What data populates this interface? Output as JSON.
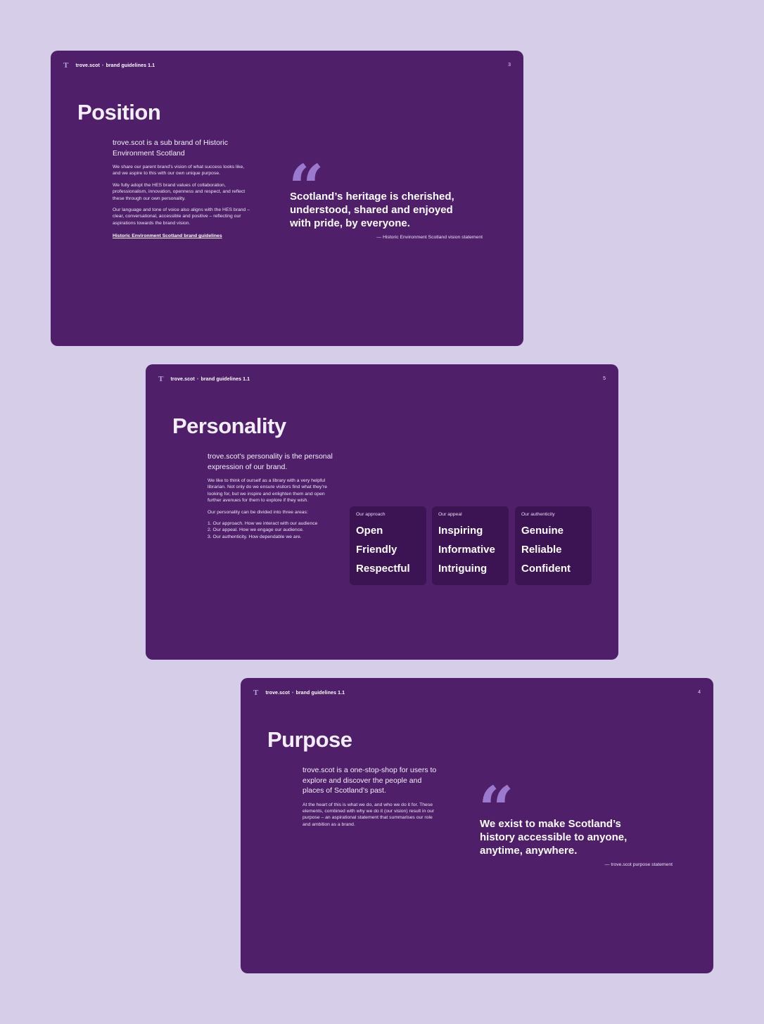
{
  "header": {
    "logo": "T",
    "brand": "trove.scot",
    "separator": "•",
    "doc": "brand guidelines 1.1"
  },
  "position": {
    "page": "3",
    "title": "Position",
    "lead": "trove.scot is a sub brand of Historic Environment Scotland",
    "paragraphs": [
      "We share our parent brand’s vision of what success looks like, and we aspire to this with our own unique purpose.",
      "We fully adopt the HES brand values of collaboration, professionalism, innovation, openness and respect, and reflect these through our own personality.",
      "Our language and tone of voice also aligns with the HES brand – clear, conversational, accessible and positive – reflecting our aspirations towards the brand vision."
    ],
    "link": "Historic Environment Scotland brand guidelines",
    "quote_mark": "“",
    "quote": "Scotland’s heritage is cherished, understood, shared and enjoyed with pride, by everyone.",
    "attribution": "— Historic Environment Scotland vision statement"
  },
  "personality": {
    "page": "5",
    "title": "Personality",
    "lead": "trove.scot’s personality is the personal expression of our brand.",
    "paragraphs": [
      "We like to think of ourself as a library with a very helpful librarian. Not only do we ensure visitors find what they’re looking for, but we inspire and enlighten them and open further avenues for them to explore if they wish.",
      "Our personality can be divided into three areas:"
    ],
    "list": [
      "1.  Our approach. How we interact with our audience",
      "2.  Our appeal. How we engage our audience.",
      "3.  Our authenticity. How dependable we are."
    ],
    "cards": [
      {
        "heading": "Our approach",
        "words": [
          "Open",
          "Friendly",
          "Respectful"
        ]
      },
      {
        "heading": "Our appeal",
        "words": [
          "Inspiring",
          "Informative",
          "Intriguing"
        ]
      },
      {
        "heading": "Our authenticity",
        "words": [
          "Genuine",
          "Reliable",
          "Confident"
        ]
      }
    ]
  },
  "purpose": {
    "page": "4",
    "title": "Purpose",
    "lead": "trove.scot is a one-stop-shop for users to explore and discover the people and places of Scotland’s past.",
    "paragraphs": [
      "At the heart of this is what we do, and who we do it for. These elements, combined with why we do it (our vision) result in our purpose – an aspirational statement that summarises our role and ambition as a brand."
    ],
    "quote_mark": "“",
    "quote": "We exist to make Scotland’s history accessible to anyone, anytime, anywhere.",
    "attribution": "— trove.scot purpose statement"
  },
  "colors": {
    "page_background": "#d6cee8",
    "slide_background": "#4f1f69",
    "card_background": "#3c1453",
    "accent": "#9b79cf"
  }
}
